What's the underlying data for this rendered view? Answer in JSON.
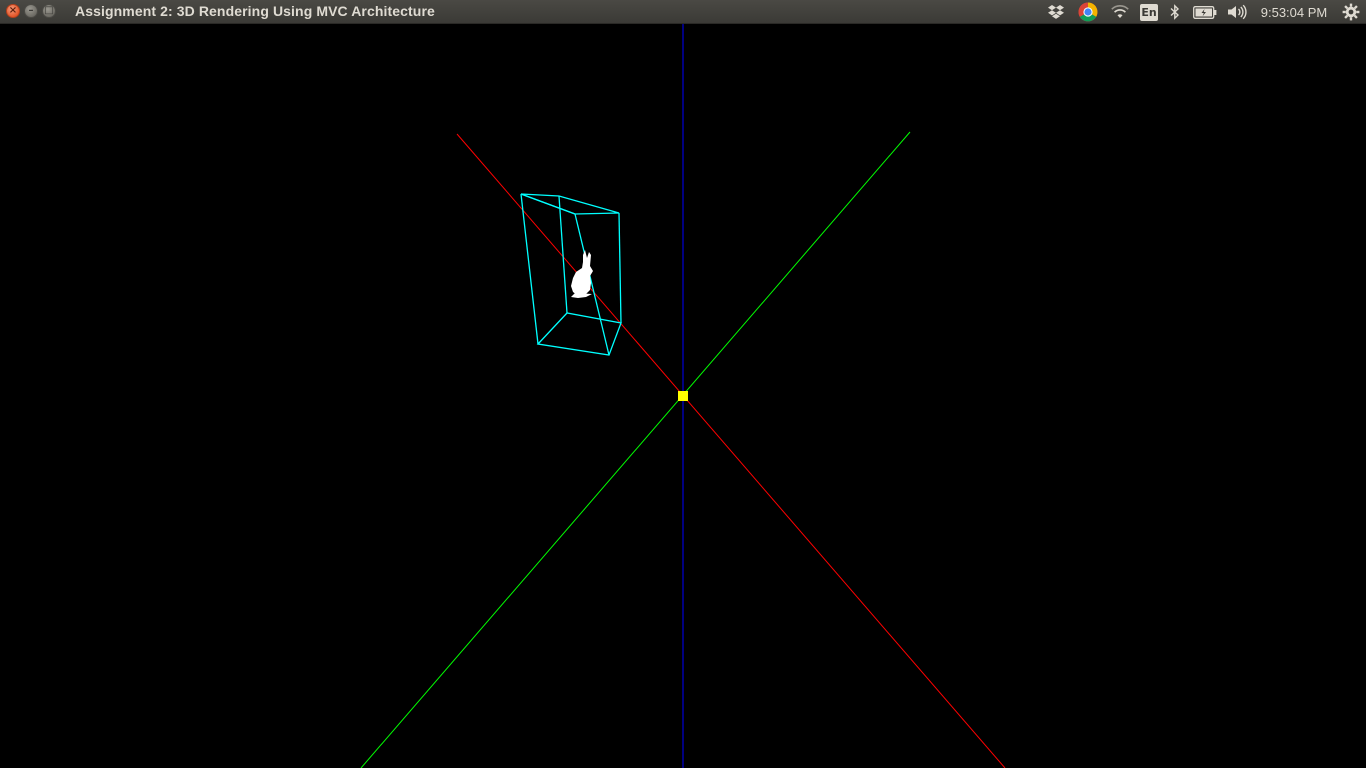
{
  "window": {
    "title": "Assignment 2: 3D Rendering Using MVC Architecture",
    "buttons": {
      "close": "×",
      "minimize": "–",
      "maximize": "□"
    }
  },
  "tray": {
    "icons": [
      "dropbox-icon",
      "chrome-icon",
      "wifi-icon",
      "keyboard-layout-icon",
      "bluetooth-icon",
      "battery-icon",
      "volume-icon",
      "settings-gear-icon"
    ],
    "keyboard_layout": "En",
    "clock": "9:53:04 PM"
  },
  "scene": {
    "background": "#000000",
    "axis_colors": {
      "x": "#ff0000",
      "y": "#00ff00",
      "z": "#0000ff"
    },
    "bounding_box_color": "#00ffff",
    "origin_marker_color": "#ffff00",
    "model": "bunny",
    "model_color": "#ffffff"
  }
}
